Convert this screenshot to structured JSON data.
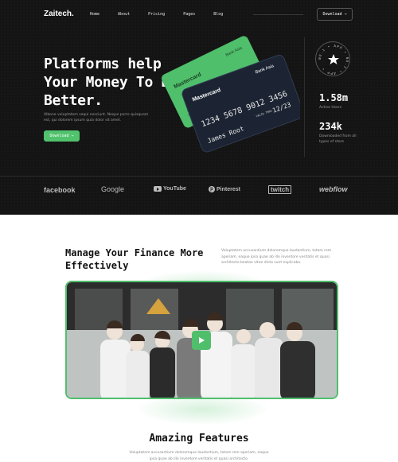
{
  "nav": {
    "logo": "Zaitech.",
    "items": [
      "Home",
      "About",
      "Pricing",
      "Pages",
      "Blog"
    ],
    "download_label": "Download",
    "download_arrow": "→"
  },
  "hero": {
    "headline": "Platforms help Your Money To Be Better.",
    "subtext": "Albone voluptatem sequi nesciunt. Neque porro quisquam est, qui dolorem ipsum quia dolor sit amet.",
    "button_label": "Download",
    "button_arrow": "→"
  },
  "cards": {
    "back": {
      "brand": "Mastercard",
      "bank": "Bank Asia"
    },
    "front": {
      "brand": "Mastercard",
      "bank": "Bank Asia",
      "number": "1234 5678 9012 3456",
      "valid_label": "VALID THRU",
      "expiry": "12/23",
      "holder": "James Root"
    }
  },
  "badge": {
    "ring_text": "NO.1 • APP • NO.1 • APP •",
    "icon": "star-icon"
  },
  "stats": [
    {
      "value": "1.58m",
      "label": "Active Users"
    },
    {
      "value": "234k",
      "label": "Downloaded from all types of store"
    }
  ],
  "brands": [
    "facebook",
    "Google",
    "YouTube",
    "Pinterest",
    "twitch",
    "webflow"
  ],
  "manage": {
    "title": "Manage Your Finance More Effectively",
    "description": "Voluptatem accusantium doloremque laudantium, totam rem aperiam, eaque ipsa quae ab illo inventore veritatis et quasi architecto beatae vitae dicta sunt explicabo."
  },
  "video": {
    "play_icon": "play-icon"
  },
  "features": {
    "title": "Amazing Features",
    "description": "Voluptatem accusantium doloremque laudantium, totam rem aperiam, eaque ipsa quae ab illo inventore veritatis et quasi architecto."
  },
  "colors": {
    "accent": "#4fbf6c",
    "dark_bg": "#141414",
    "card_navy": "#1c2433"
  }
}
